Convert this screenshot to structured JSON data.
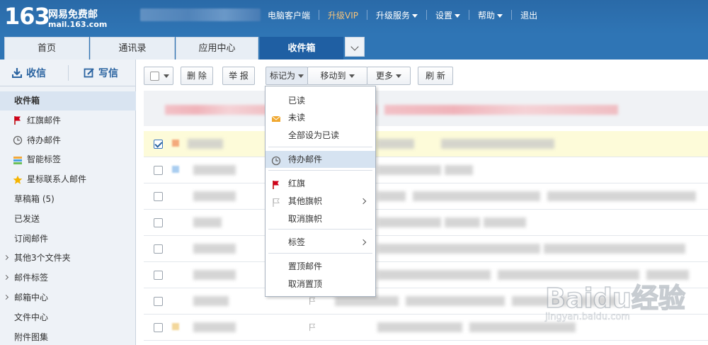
{
  "brand": {
    "number": "163",
    "name": "网易免费邮",
    "url": "mail.163.com"
  },
  "topnav": [
    {
      "label": "电脑客户端",
      "dropdown": false,
      "vip": false
    },
    {
      "label": "升级VIP",
      "dropdown": false,
      "vip": true
    },
    {
      "label": "升级服务",
      "dropdown": true,
      "vip": false
    },
    {
      "label": "设置",
      "dropdown": true,
      "vip": false
    },
    {
      "label": "帮助",
      "dropdown": true,
      "vip": false
    },
    {
      "label": "退出",
      "dropdown": false,
      "vip": false
    }
  ],
  "tabs": [
    {
      "label": "首页",
      "active": false
    },
    {
      "label": "通讯录",
      "active": false
    },
    {
      "label": "应用中心",
      "active": false
    },
    {
      "label": "收件箱",
      "active": true
    }
  ],
  "sidebar": {
    "receive_label": "收信",
    "compose_label": "写信",
    "folders": [
      {
        "label": "收件箱",
        "icon": "",
        "active": true,
        "expandable": false
      },
      {
        "label": "红旗邮件",
        "icon": "red-flag-icon",
        "active": false,
        "expandable": false
      },
      {
        "label": "待办邮件",
        "icon": "clock-icon",
        "active": false,
        "expandable": false
      },
      {
        "label": "智能标签",
        "icon": "tag-stripes-icon",
        "active": false,
        "expandable": false
      },
      {
        "label": "星标联系人邮件",
        "icon": "star-icon",
        "active": false,
        "expandable": false
      },
      {
        "label": "草稿箱 (5)",
        "icon": "",
        "active": false,
        "expandable": false
      },
      {
        "label": "已发送",
        "icon": "",
        "active": false,
        "expandable": false
      },
      {
        "label": "订阅邮件",
        "icon": "",
        "active": false,
        "expandable": false
      },
      {
        "label": "其他3个文件夹",
        "icon": "",
        "active": false,
        "expandable": true
      },
      {
        "label": "邮件标签",
        "icon": "",
        "active": false,
        "expandable": true
      },
      {
        "label": "邮箱中心",
        "icon": "",
        "active": false,
        "expandable": true
      },
      {
        "label": "文件中心",
        "icon": "",
        "active": false,
        "expandable": false
      },
      {
        "label": "附件图集",
        "icon": "",
        "active": false,
        "expandable": false
      }
    ]
  },
  "toolbar": {
    "delete_label": "删 除",
    "report_label": "举 报",
    "mark_as_label": "标记为",
    "move_to_label": "移动到",
    "more_label": "更多",
    "refresh_label": "刷 新"
  },
  "mark_menu": {
    "items": [
      {
        "label": "已读",
        "icon": "",
        "highlight": false,
        "submenu": false
      },
      {
        "label": "未读",
        "icon": "envelope-icon",
        "highlight": false,
        "submenu": false
      },
      {
        "label": "全部设为已读",
        "icon": "",
        "highlight": false,
        "submenu": false
      },
      {
        "label": "待办邮件",
        "icon": "clock-icon",
        "highlight": true,
        "submenu": false
      },
      {
        "label": "红旗",
        "icon": "red-flag-icon",
        "highlight": false,
        "submenu": false
      },
      {
        "label": "其他旗帜",
        "icon": "grey-flag-icon",
        "highlight": false,
        "submenu": true
      },
      {
        "label": "取消旗帜",
        "icon": "",
        "highlight": false,
        "submenu": false
      },
      {
        "label": "标签",
        "icon": "",
        "highlight": false,
        "submenu": true
      },
      {
        "label": "置顶邮件",
        "icon": "",
        "highlight": false,
        "submenu": false
      },
      {
        "label": "取消置顶",
        "icon": "",
        "highlight": false,
        "submenu": false
      }
    ]
  },
  "mail_rows": [
    {
      "checked": true,
      "selected": true,
      "chip_color": "#f4a97c",
      "flag": false
    },
    {
      "checked": false,
      "selected": false,
      "chip_color": "#a9cdf0",
      "flag": false
    },
    {
      "checked": false,
      "selected": false,
      "chip_color": "",
      "flag": false
    },
    {
      "checked": false,
      "selected": false,
      "chip_color": "",
      "flag": false
    },
    {
      "checked": false,
      "selected": false,
      "chip_color": "",
      "flag": false
    },
    {
      "checked": false,
      "selected": false,
      "chip_color": "",
      "flag": false
    },
    {
      "checked": false,
      "selected": false,
      "chip_color": "",
      "flag": true
    },
    {
      "checked": false,
      "selected": false,
      "chip_color": "#f3d79a",
      "flag": true
    }
  ],
  "watermark": {
    "brand": "Baidu经验",
    "url": "jingyan.baidu.com"
  },
  "colors": {
    "header_blue": "#2f75b5",
    "active_tab": "#1f5fa3",
    "sidebar_bg": "#eef2f7",
    "menu_highlight": "#d6e3f1",
    "selected_row": "#fdfbd9"
  }
}
